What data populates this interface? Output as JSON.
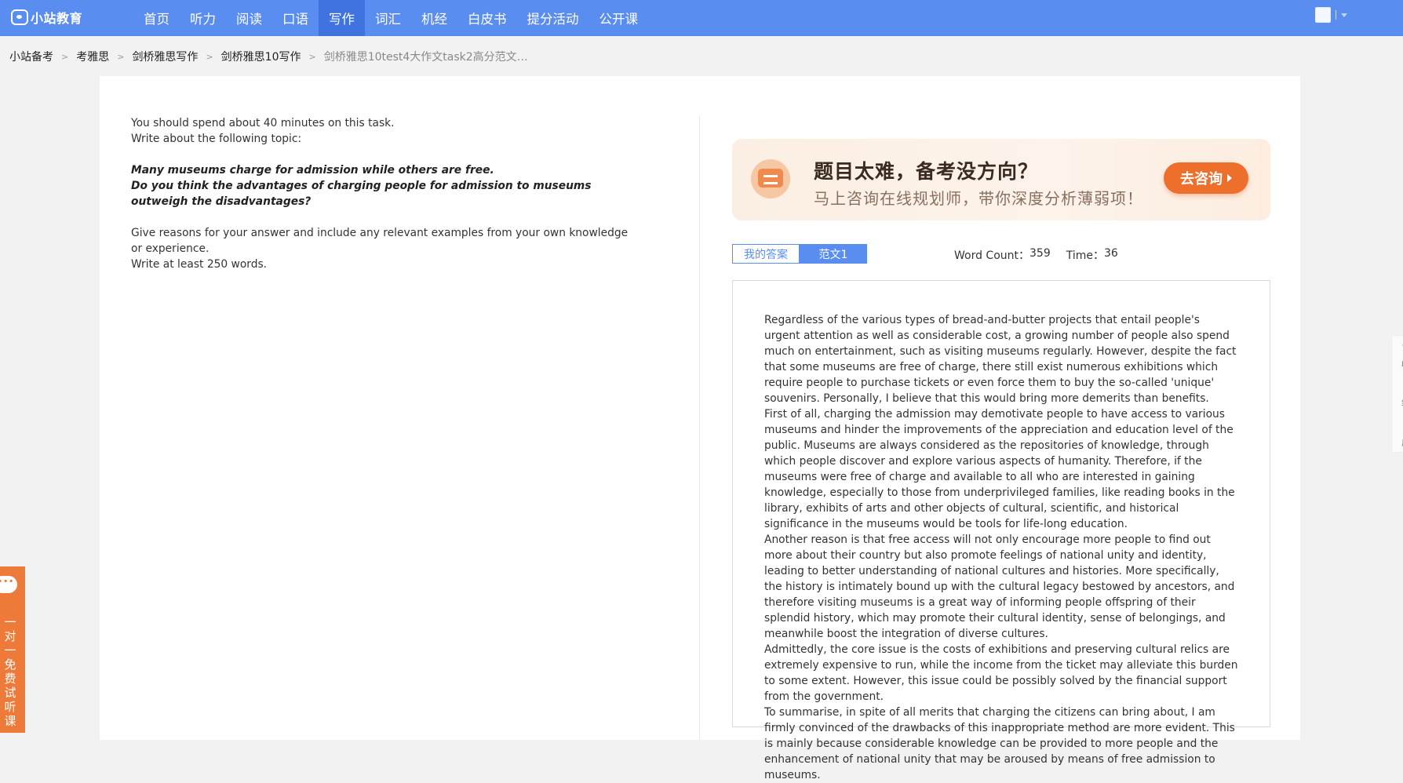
{
  "header": {
    "logo_text": "小站教育",
    "nav": [
      "首页",
      "听力",
      "阅读",
      "口语",
      "写作",
      "词汇",
      "机经",
      "白皮书",
      "提分活动",
      "公开课"
    ],
    "active_nav": "写作"
  },
  "breadcrumb": {
    "items": [
      "小站备考",
      "考雅思",
      "剑桥雅思写作",
      "剑桥雅思10写作"
    ],
    "current": "剑桥雅思10test4大作文task2高分范文…",
    "separator": ">"
  },
  "question": {
    "line1": "You should spend about 40 minutes on this task.",
    "line2": "Write about the following topic:",
    "topic1": "Many museums charge for admission while others are free.",
    "topic2": "Do you think the advantages of charging people for admission to museums outweigh the disadvantages?",
    "line3": "Give reasons for your answer and include any relevant examples from your own knowledge or experience.",
    "line4": "Write at least 250 words."
  },
  "banner": {
    "title": "题目太难，备考没方向？",
    "subtitle": "马上咨询在线规划师，带你深度分析薄弱项！",
    "button": "去咨询"
  },
  "tabs": {
    "my_answer": "我的答案",
    "sample": "范文1",
    "active": "范文1"
  },
  "stats": {
    "word_count_label": "Word Count：",
    "word_count": "359",
    "time_label": "Time：",
    "time": "36"
  },
  "essay": {
    "paragraphs": [
      "Regardless of the various types of bread-and-butter projects that entail people's urgent attention as well as considerable cost, a growing number of people also spend much on entertainment, such as visiting museums regularly. However, despite the fact that some museums are free of charge, there still exist numerous exhibitions which require people to purchase tickets or even force them to buy the so-called 'unique' souvenirs. Personally, I believe that this would bring more demerits than benefits.",
      "First of all, charging the admission may demotivate people to have access to various museums and hinder the improvements of the appreciation and education level of the public. Museums are always considered as the repositories of knowledge, through which people discover and explore various aspects of humanity. Therefore, if the museums were free of charge and available to all who are interested in gaining knowledge, especially to those from underprivileged families, like reading books in the library, exhibits of arts and other objects of cultural, scientific, and historical significance in the museums would be tools for life-long education.",
      "Another reason is that free access will not only encourage more people to find out more about their country but also promote feelings of national unity and identity, leading to better understanding of national cultures and histories. More specifically, the history is intimately bound up with the cultural legacy bestowed by ancestors, and therefore visiting museums is a great way of informing people offspring of their splendid history, which may promote their cultural identity, sense of belongings, and meanwhile boost the integration of diverse cultures.",
      "Admittedly, the core issue is the costs of exhibitions and preserving cultural relics are extremely expensive to run, while the income from the ticket may alleviate this burden to some extent. However, this issue could be possibly solved by the financial support from the government.",
      "To summarise, in spite of all merits that charging the citizens can bring about, I am firmly convinced of the drawbacks of this inappropriate method are more evident. This is mainly because considerable knowledge can be provided to more people and the enhancement of national unity that may be aroused by means of free admission to museums."
    ]
  },
  "side_tools": {
    "favorite": "收藏",
    "note": "笔记",
    "feedback": "反馈",
    "icons": [
      "star-icon",
      "pencil-icon",
      "edit-note-icon"
    ]
  },
  "consult_bar": {
    "text": "一对一免费试听课",
    "icon": "chat-bubble-icon"
  },
  "colors": {
    "primary": "#5a8df0",
    "nav_active": "#3f73df",
    "accent_orange": "#ee6e2c",
    "page_bg": "#f2f2f3"
  }
}
